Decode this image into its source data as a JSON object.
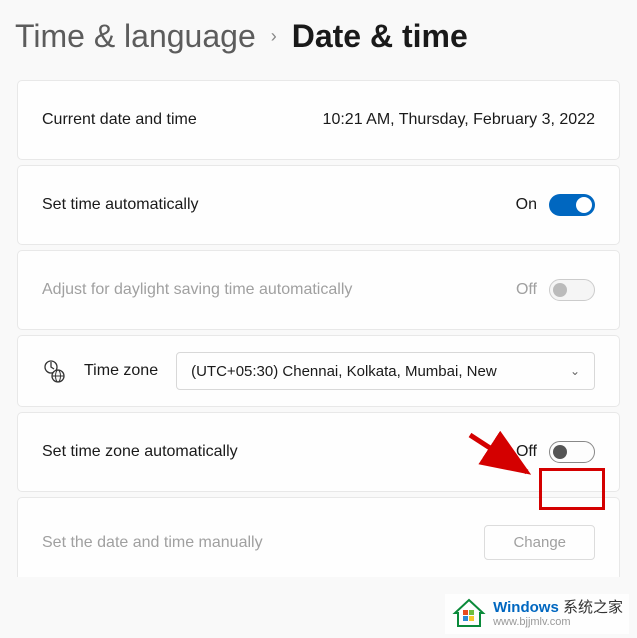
{
  "breadcrumb": {
    "back": "Time & language",
    "current": "Date & time"
  },
  "currentDateTime": {
    "label": "Current date and time",
    "value": "10:21 AM, Thursday, February 3, 2022"
  },
  "setTimeAuto": {
    "label": "Set time automatically",
    "state": "On"
  },
  "daylightSaving": {
    "label": "Adjust for daylight saving time automatically",
    "state": "Off"
  },
  "timeZone": {
    "label": "Time zone",
    "selected": "(UTC+05:30) Chennai, Kolkata, Mumbai, New"
  },
  "setTimeZoneAuto": {
    "label": "Set time zone automatically",
    "state": "Off"
  },
  "setManually": {
    "label": "Set the date and time manually",
    "button": "Change"
  },
  "watermark": {
    "brand": "Windows",
    "suffix": "系统之家",
    "url": "www.bjjmlv.com"
  }
}
